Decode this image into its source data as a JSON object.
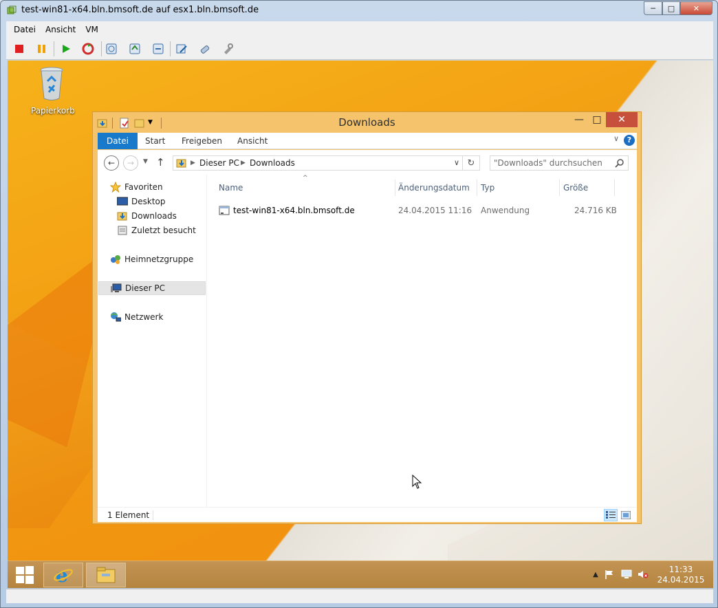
{
  "vm_window": {
    "title": "test-win81-x64.bln.bmsoft.de auf esx1.bln.bmsoft.de",
    "menu": [
      "Datei",
      "Ansicht",
      "VM"
    ],
    "toolbar_icons": [
      "power-off-icon",
      "pause-icon",
      "play-icon",
      "reset-icon",
      "snapshot-icon",
      "revert-snapshot-icon",
      "snapshot-manager-icon",
      "edit-settings-icon",
      "connect-devices-icon",
      "install-tools-icon"
    ]
  },
  "desktop": {
    "icons": [
      {
        "label": "Papierkorb",
        "icon": "recycle-bin-icon"
      }
    ]
  },
  "explorer": {
    "title": "Downloads",
    "ribbon_tabs": [
      "Datei",
      "Start",
      "Freigeben",
      "Ansicht"
    ],
    "address": {
      "segments": [
        "Dieser PC",
        "Downloads"
      ]
    },
    "search": {
      "placeholder": "\"Downloads\" durchsuchen"
    },
    "nav": {
      "favorites": "Favoriten",
      "favorites_items": [
        "Desktop",
        "Downloads",
        "Zuletzt besucht"
      ],
      "homegroup": "Heimnetzgruppe",
      "this_pc": "Dieser PC",
      "network": "Netzwerk"
    },
    "columns": [
      "Name",
      "Änderungsdatum",
      "Typ",
      "Größe"
    ],
    "files": [
      {
        "name": "test-win81-x64.bln.bmsoft.de",
        "modified": "24.04.2015 11:16",
        "type": "Anwendung",
        "size": "24.716 KB"
      }
    ],
    "status": "1 Element"
  },
  "taskbar": {
    "time": "11:33",
    "date": "24.04.2015"
  },
  "colors": {
    "file_tab": "#1979ca",
    "window_frame": "#f4c36c",
    "close_button": "#c7503d"
  }
}
